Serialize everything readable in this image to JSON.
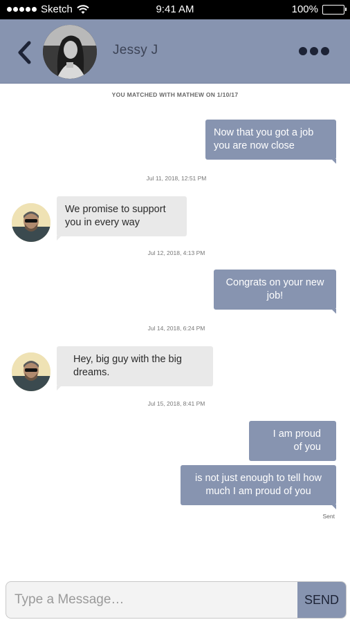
{
  "status_bar": {
    "carrier": "Sketch",
    "time": "9:41 AM",
    "battery": "100%"
  },
  "header": {
    "contact_name": "Jessy J",
    "back_icon": "chevron-left-icon",
    "more_icon": "ellipsis-icon"
  },
  "chat": {
    "matched_notice": "YOU MATCHED WITH MATHEW ON 1/10/17",
    "messages": [
      {
        "direction": "outgoing",
        "text_line1": "Now that you got a job",
        "text_line2": "you are now close"
      },
      {
        "direction": "incoming",
        "text_line1": "We promise to support",
        "text_line2": "you in every way"
      },
      {
        "direction": "outgoing",
        "text_line1": "Congrats on your new",
        "text_line2": "job!"
      },
      {
        "direction": "incoming",
        "text_line1": "Hey, big guy with the big",
        "text_line2": "dreams."
      },
      {
        "direction": "outgoing",
        "text_line1": "I am proud",
        "text_line2": "of you"
      },
      {
        "direction": "outgoing",
        "text_line1": "is not just enough to tell how",
        "text_line2": "much I am proud of you"
      }
    ],
    "timestamps": [
      "Jul 11, 2018, 12:51 PM",
      "Jul 12, 2018, 4:13 PM",
      "Jul 14, 2018, 6:24 PM",
      "Jul 15, 2018, 8:41 PM"
    ],
    "sent_label": "Sent"
  },
  "composer": {
    "placeholder": "Type a Message…",
    "send_label": "SEND"
  },
  "colors": {
    "accent": "#8794b0",
    "incoming_bubble": "#e9e9e9",
    "dark_text": "#1d2336"
  }
}
